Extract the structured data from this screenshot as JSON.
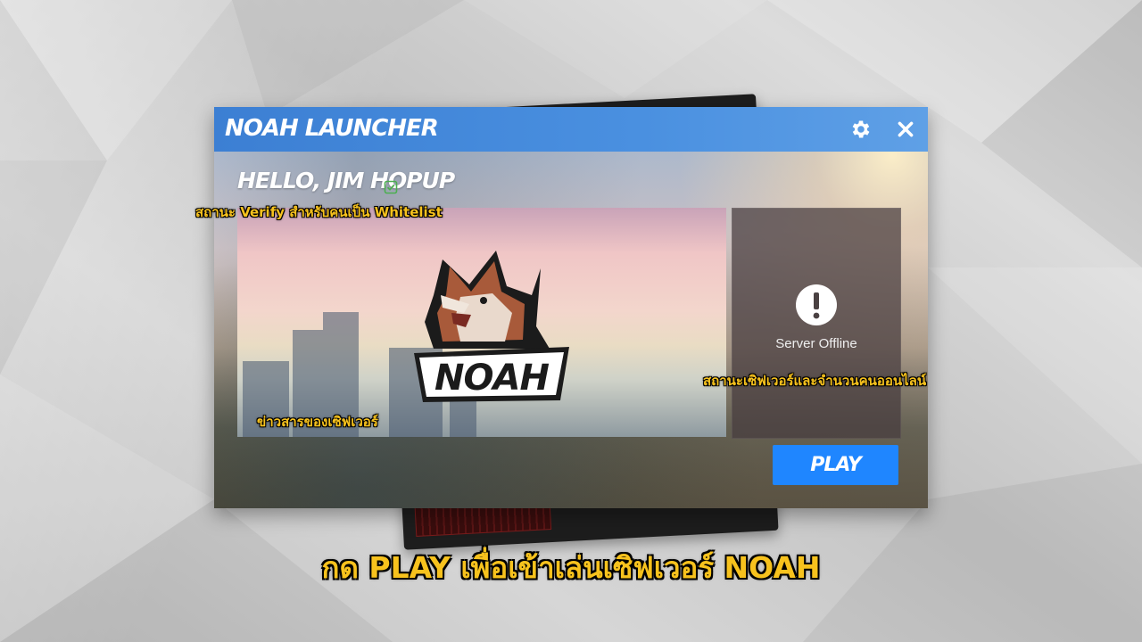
{
  "window": {
    "title": "NOAH LAUNCHER",
    "settings_icon": "gear-icon",
    "close_icon": "close-icon",
    "accent": "#4a90e0"
  },
  "user": {
    "greeting": "HELLO, JIM HOPUP",
    "verified_icon": "verified-check-icon"
  },
  "news": {
    "logo_text": "NOAH"
  },
  "server": {
    "status_icon": "exclamation-icon",
    "status_text": "Server Offline"
  },
  "play_button": {
    "label": "PLAY",
    "color": "#1f86ff"
  },
  "annotations": {
    "verify": "สถานะ Verify สำหรับคนเป็น Whitelist",
    "news": "ข่าวสารของเซิฟเวอร์",
    "status": "สถานะเซิฟเวอร์และจำนวนคนออนไลน์",
    "bottom": "กด PLAY เพื่อเข้าเล่นเซิฟเวอร์ NOAH",
    "color": "#f7c21d"
  }
}
